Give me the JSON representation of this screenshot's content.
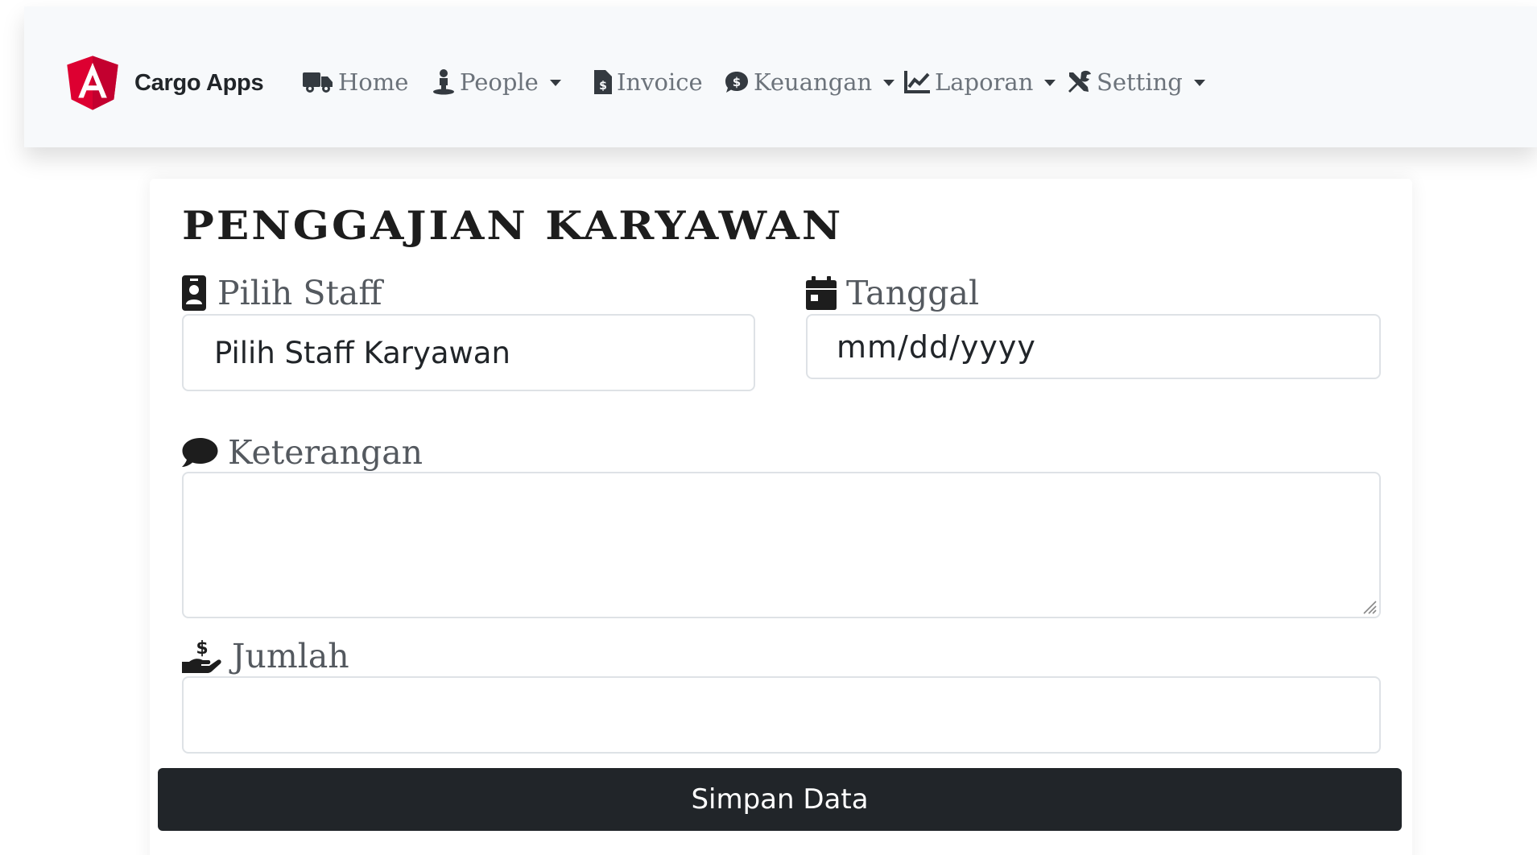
{
  "navbar": {
    "brand_name": "Cargo Apps",
    "brand_color": "#dd0031",
    "items": [
      {
        "label": "Home",
        "icon": "truck-icon",
        "dropdown": false
      },
      {
        "label": "People",
        "icon": "person-icon",
        "dropdown": true
      },
      {
        "label": "Invoice",
        "icon": "file-invoice-icon",
        "dropdown": false
      },
      {
        "label": "Keuangan",
        "icon": "money-comment-icon",
        "dropdown": true
      },
      {
        "label": "Laporan",
        "icon": "chart-line-icon",
        "dropdown": true
      },
      {
        "label": "Setting",
        "icon": "tools-icon",
        "dropdown": true
      }
    ]
  },
  "form": {
    "title": "PENGGAJIAN KARYAWAN",
    "staff": {
      "label": "Pilih Staff",
      "value": "Pilih Staff Karyawan",
      "icon": "id-badge-icon"
    },
    "date": {
      "label": "Tanggal",
      "placeholder": "mm/dd/yyyy",
      "icon": "calendar-icon"
    },
    "note": {
      "label": "Keterangan",
      "value": "",
      "icon": "comment-icon"
    },
    "amount": {
      "label": "Jumlah",
      "value": "",
      "icon": "hand-holding-usd-icon"
    },
    "submit_label": "Simpan Data"
  },
  "colors": {
    "navbar_bg": "#f7f9fb",
    "button_bg": "#212529",
    "nav_text": "#6c737b"
  }
}
